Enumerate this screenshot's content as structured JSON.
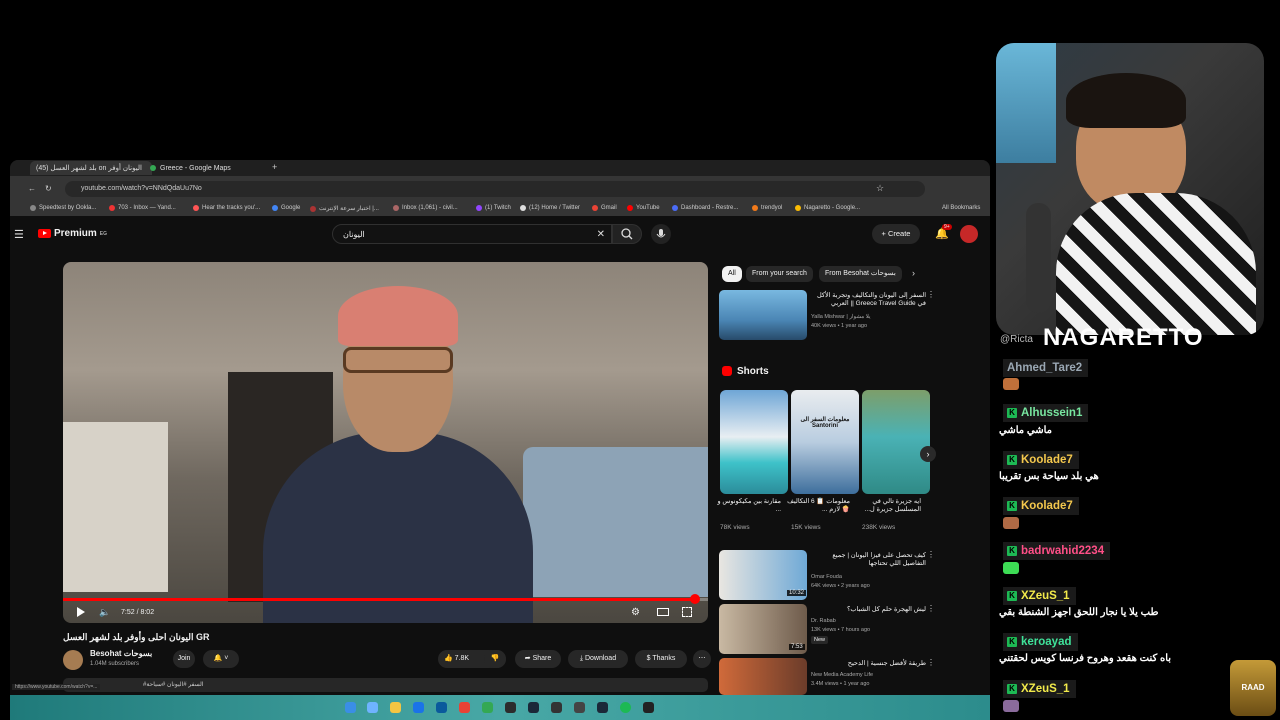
{
  "browser": {
    "tabs": [
      {
        "label": "(45) بلد لشهر العسل on اليونان أوفر",
        "active": true
      },
      {
        "label": "Greece - Google Maps",
        "active": false
      }
    ],
    "url": "youtube.com/watch?v=NNdQdaUu7No",
    "bookmarks": [
      "Speedtest by Ookla...",
      "703 - Inbox — Yand...",
      "Hear the tracks you'...",
      "Google",
      "اختبار سرعة الإنترنت |...",
      "Inbox (1,061) - civil...",
      "(1) Twitch",
      "(12) Home / Twitter",
      "Gmail",
      "YouTube",
      "Dashboard - Restre...",
      "trendyol",
      "Nagaretto - Google...",
      "All Bookmarks"
    ],
    "status_url": "https://www.youtube.com/watch?v=..."
  },
  "youtube": {
    "logo": "Premium",
    "logo_region": "EG",
    "search_value": "اليونان",
    "create_label": "Create",
    "notif_count": "9+",
    "video": {
      "time": "7:52 / 8:02",
      "progress": 0.98,
      "title": "اليونان احلى وأوفر بلد لشهر العسل GR",
      "channel": "Besohat بسوحات",
      "subscribers": "1.04M subscribers",
      "join_label": "Join",
      "likes": "7.8K",
      "share_label": "Share",
      "download_label": "Download",
      "thanks_label": "Thanks",
      "description_snippet": "#السفر #اليونان #سياحة"
    },
    "chips": [
      "All",
      "From your search",
      "From Besohat بسوحات"
    ],
    "top_rec": {
      "title": "السفر إلى اليونان والتكاليف وتجربة الأكل في Greece Travel Guide || العربي",
      "channel": "Yalla Mishwar | يلا مشوار",
      "meta": "40K views • 1 year ago"
    },
    "shorts_label": "Shorts",
    "shorts": [
      {
        "title": "مقارنة بين مكيكونوس و ...",
        "views": "78K views",
        "overlay": ""
      },
      {
        "title": "معلومات 📋 6 التكاليف 🍿 لازم ...",
        "views": "15K views",
        "overlay": "معلومات السفر الى Santorini"
      },
      {
        "title": "ايه جزيرة تالي في المسلسل جزيرة ل...",
        "views": "238K views",
        "overlay": ""
      }
    ],
    "recs": [
      {
        "title": "كيف تحصل على فيزا اليونان | جميع التفاصيل اللي تحتاجها",
        "channel": "Omar Fouda",
        "meta": "64K views • 2 years ago",
        "duration": "10:32",
        "badge": ""
      },
      {
        "title": "ليش الهجرة حلم كل الشباب؟",
        "channel": "Dr. Rabab",
        "meta": "13K views • 7 hours ago",
        "duration": "7:53",
        "badge": "New"
      },
      {
        "title": "طريقة لأفضل جنسية | الدحيح",
        "channel": "New Media Academy Life",
        "meta": "3.4M views • 1 year ago",
        "duration": "",
        "badge": ""
      }
    ]
  },
  "stream": {
    "streamer_name": "NAGARETTO",
    "partial_user": "@Ricta",
    "chat": [
      {
        "user": "Ahmed_Tare2",
        "color": "#9aa7b3",
        "message": ""
      },
      {
        "user": "Alhussein1",
        "color": "#78e6a0",
        "message": "ماشي ماشي"
      },
      {
        "user": "Koolade7",
        "color": "#f4c84d",
        "message": "هي بلد سياحة بس تقريبا"
      },
      {
        "user": "Koolade7",
        "color": "#f4c84d",
        "message": ""
      },
      {
        "user": "badrwahid2234",
        "color": "#ff4f87",
        "message": ""
      },
      {
        "user": "XZeuS_1",
        "color": "#f2ea4b",
        "message": "طب يلا يا نجار اللحق اجهز الشنطة بقي"
      },
      {
        "user": "keroayad",
        "color": "#3fe39a",
        "message": "باه كنت هقعد وهروح فرنسا كويس لحقتني"
      },
      {
        "user": "XZeuS_1",
        "color": "#f2ea4b",
        "message": ""
      }
    ],
    "logo_text": "RAAD"
  }
}
